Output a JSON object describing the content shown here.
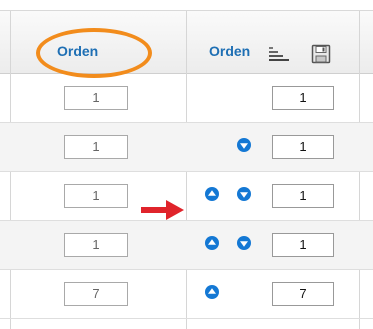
{
  "header": {
    "col1_label": "Orden",
    "col2_label": "Orden"
  },
  "rows": [
    {
      "order_value": "1",
      "new_order_value": "1",
      "can_move_up": false,
      "can_move_down": false
    },
    {
      "order_value": "1",
      "new_order_value": "1",
      "can_move_up": false,
      "can_move_down": true
    },
    {
      "order_value": "1",
      "new_order_value": "1",
      "can_move_up": true,
      "can_move_down": true
    },
    {
      "order_value": "1",
      "new_order_value": "1",
      "can_move_up": true,
      "can_move_down": true
    },
    {
      "order_value": "7",
      "new_order_value": "7",
      "can_move_up": true,
      "can_move_down": false
    }
  ],
  "colors": {
    "highlight_circle": "#f28c1c",
    "pointer_arrow": "#e0242b",
    "header_text": "#1e6fb4",
    "move_button": "#1478d4"
  },
  "icons": {
    "sort": "sort-order-icon",
    "save": "save-order-icon",
    "up": "move-up-icon",
    "down": "move-down-icon"
  }
}
